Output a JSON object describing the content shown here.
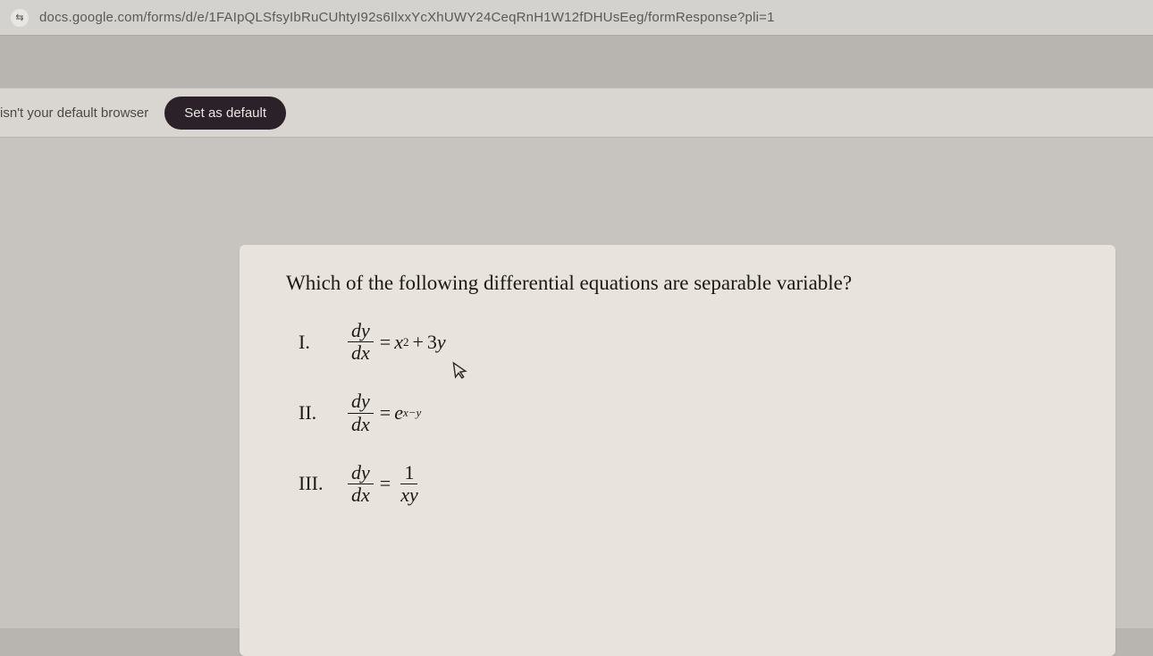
{
  "url_bar": {
    "icon_glyph": "⇆",
    "url": "docs.google.com/forms/d/e/1FAIpQLSfsyIbRuCUhtyI92s6IlxxYcXhUWY24CeqRnH1W12fDHUsEeg/formResponse?pli=1"
  },
  "default_prompt": {
    "message": "isn't your default browser",
    "button_label": "Set as default"
  },
  "question": {
    "prompt": "Which of the following differential equations are separable variable?",
    "items": {
      "i": {
        "roman": "I.",
        "lhs_num": "dy",
        "lhs_den": "dx",
        "eq": "=",
        "rhs_a": "x",
        "rhs_a_sup": "2",
        "plus": "+",
        "rhs_b_coef": "3",
        "rhs_b_var": "y"
      },
      "ii": {
        "roman": "II.",
        "lhs_num": "dy",
        "lhs_den": "dx",
        "eq": "=",
        "base": "e",
        "exp": "x−y"
      },
      "iii": {
        "roman": "III.",
        "lhs_num": "dy",
        "lhs_den": "dx",
        "eq": "=",
        "rhs_num": "1",
        "rhs_den": "xy"
      }
    }
  }
}
